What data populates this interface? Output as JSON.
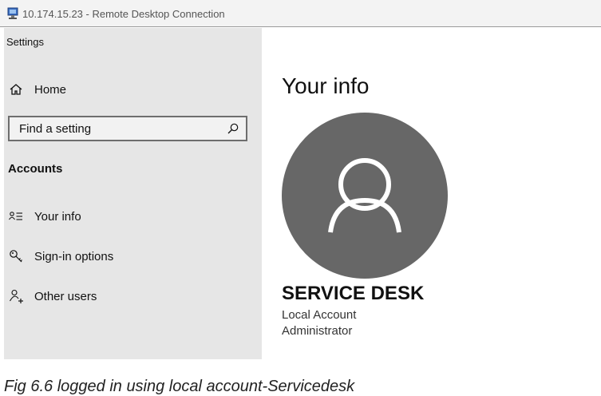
{
  "window": {
    "title": "10.174.15.23 - Remote Desktop Connection",
    "icon": "remote-desktop-icon"
  },
  "settings": {
    "app_title": "Settings",
    "home_label": "Home",
    "search_placeholder": "Find a setting",
    "section_title": "Accounts",
    "nav": {
      "your_info": "Your info",
      "sign_in_options": "Sign-in options",
      "other_users": "Other users"
    }
  },
  "main": {
    "page_title": "Your info",
    "avatar_icon": "user-silhouette-icon",
    "user_name": "SERVICE DESK",
    "account_type": "Local Account",
    "account_role": "Administrator"
  },
  "caption": "Fig 6.6 logged in using local account-Servicedesk",
  "colors": {
    "sidebar_bg": "#e6e6e6",
    "avatar_bg": "#676767",
    "titlebar_bg": "#f3f3f3"
  }
}
